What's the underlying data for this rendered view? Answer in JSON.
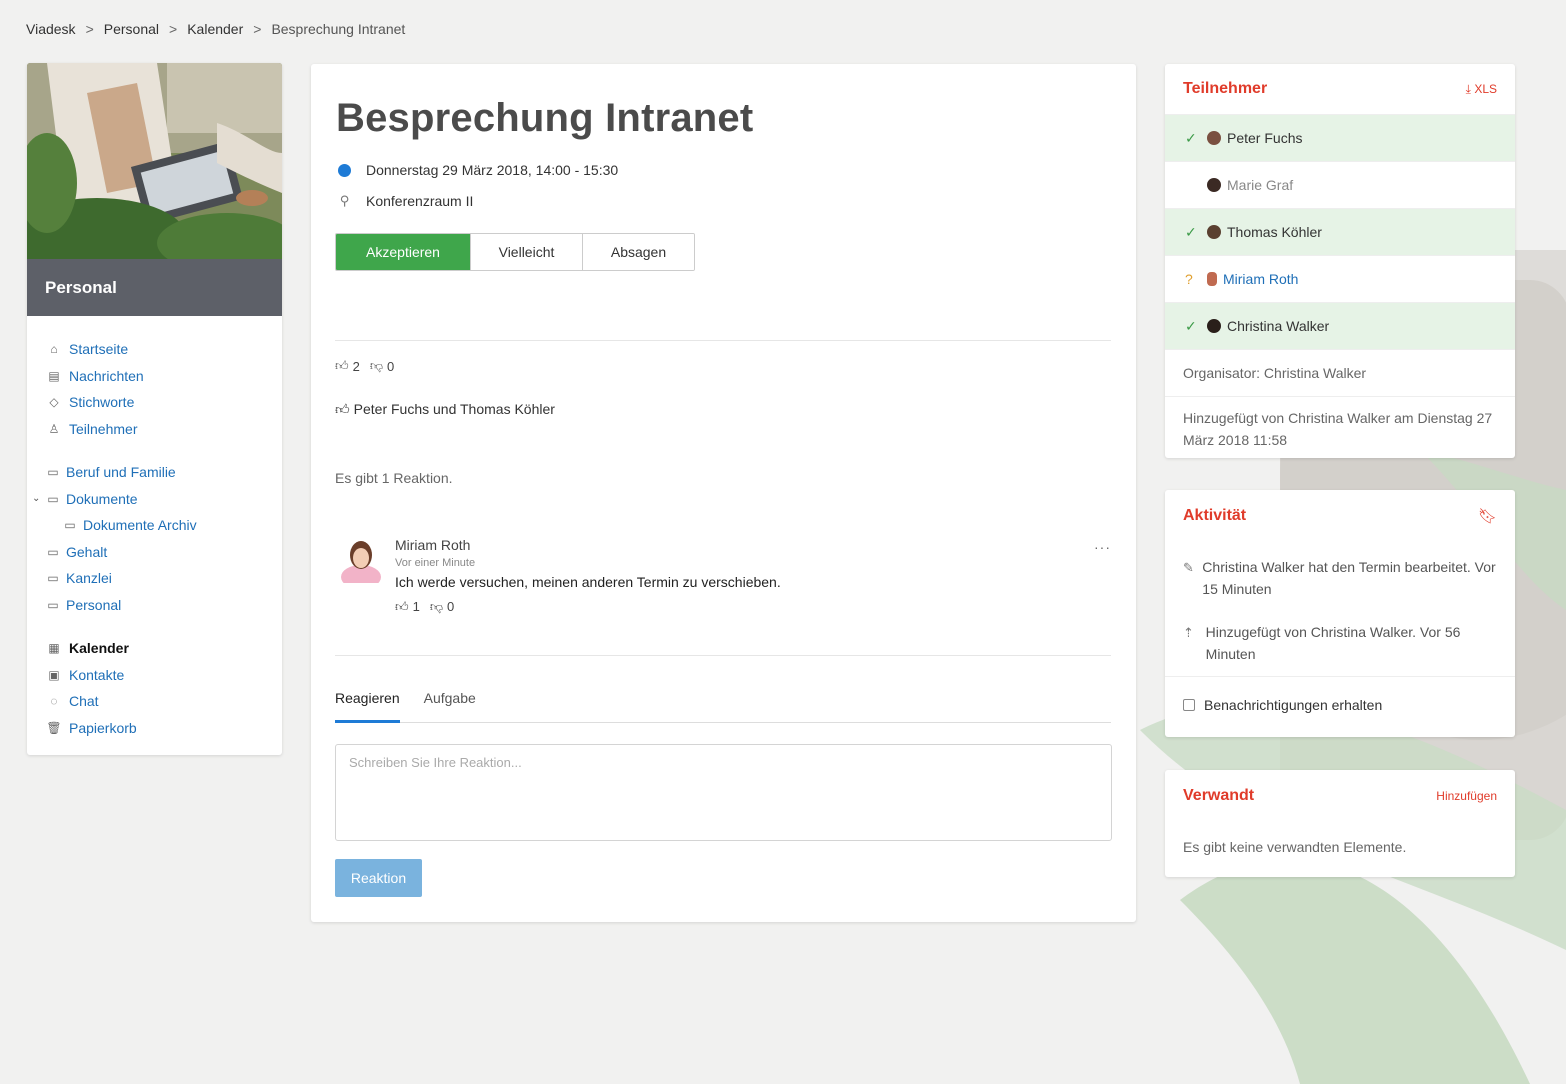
{
  "breadcrumb": [
    "Viadesk",
    "Personal",
    "Kalender",
    "Besprechung Intranet"
  ],
  "sidebar": {
    "header": "Personal",
    "items": [
      {
        "label": "Startseite",
        "icon": "home-icon"
      },
      {
        "label": "Nachrichten",
        "icon": "news-icon"
      },
      {
        "label": "Stichworte",
        "icon": "tag-icon"
      },
      {
        "label": "Teilnehmer",
        "icon": "user-icon"
      }
    ],
    "folders": [
      {
        "label": "Beruf und Familie"
      },
      {
        "label": "Dokumente"
      },
      {
        "label": "Dokumente Archiv"
      },
      {
        "label": "Gehalt"
      },
      {
        "label": "Kanzlei"
      },
      {
        "label": "Personal"
      }
    ],
    "apps": [
      {
        "label": "Kalender",
        "icon": "calendar-icon"
      },
      {
        "label": "Kontakte",
        "icon": "contacts-icon"
      },
      {
        "label": "Chat",
        "icon": "chat-icon"
      },
      {
        "label": "Papierkorb",
        "icon": "trash-icon"
      }
    ]
  },
  "event": {
    "title": "Besprechung Intranet",
    "datetime": "Donnerstag 29 März 2018, 14:00 - 15:30",
    "location": "Konferenzraum II",
    "buttons": {
      "accept": "Akzeptieren",
      "maybe": "Vielleicht",
      "decline": "Absagen"
    },
    "likes": "2",
    "dislikes": "0",
    "liked_by": "Peter Fuchs und Thomas Köhler",
    "reactions_count": "Es gibt 1 Reaktion."
  },
  "comment": {
    "author": "Miriam Roth",
    "time": "Vor einer Minute",
    "text": "Ich werde versuchen, meinen anderen Termin zu verschieben.",
    "likes": "1",
    "dislikes": "0",
    "more": "···"
  },
  "tabs": [
    "Reagieren",
    "Aufgabe"
  ],
  "reply": {
    "placeholder": "Schreiben Sie Ihre Reaktion...",
    "button": "Reaktion"
  },
  "participants": {
    "title": "Teilnehmer",
    "export": "XLS",
    "list": [
      {
        "name": "Peter Fuchs",
        "status": "accepted"
      },
      {
        "name": "Marie Graf",
        "status": "none"
      },
      {
        "name": "Thomas Köhler",
        "status": "accepted"
      },
      {
        "name": "Miriam Roth",
        "status": "maybe"
      },
      {
        "name": "Christina Walker",
        "status": "accepted"
      }
    ],
    "organizer": "Organisator: Christina Walker",
    "added": "Hinzugefügt von Christina Walker am Dienstag 27 März 2018 11:58"
  },
  "activity": {
    "title": "Aktivität",
    "items": [
      {
        "icon": "pencil-icon",
        "text": "Christina Walker hat den Termin bearbeitet. Vor 15 Minuten"
      },
      {
        "icon": "upload-icon",
        "text": "Hinzugefügt von Christina Walker. Vor 56 Minuten"
      }
    ],
    "notify": "Benachrichtigungen erhalten"
  },
  "related": {
    "title": "Verwandt",
    "add": "Hinzufügen",
    "empty": "Es gibt keine verwandten Elemente."
  },
  "colors": {
    "accent_red": "#e03b2a",
    "accept_green": "#3fa64b",
    "link_blue": "#1f6fb7",
    "reply_button": "#7ab3de"
  }
}
